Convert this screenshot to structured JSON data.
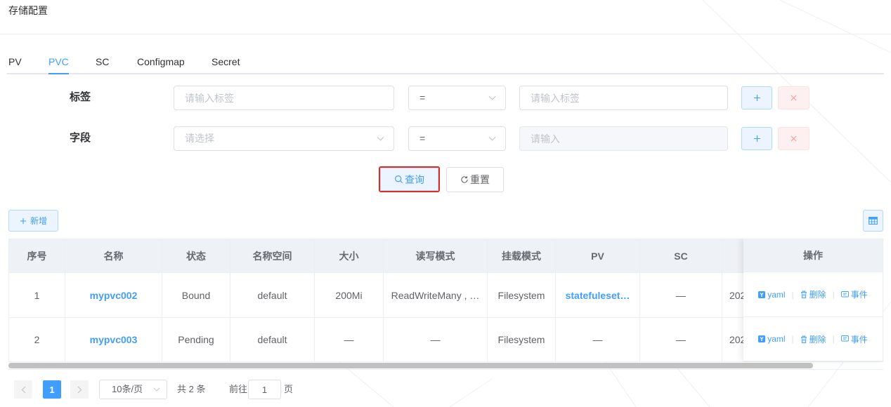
{
  "page": {
    "title": "存储配置"
  },
  "tabs": [
    {
      "label": "PV",
      "active": false
    },
    {
      "label": "PVC",
      "active": true
    },
    {
      "label": "SC",
      "active": false
    },
    {
      "label": "Configmap",
      "active": false
    },
    {
      "label": "Secret",
      "active": false
    }
  ],
  "filters": {
    "label_row": {
      "label": "标签",
      "key_placeholder": "请输入标签",
      "operator": "=",
      "value_placeholder": "请输入标签"
    },
    "field_row": {
      "label": "字段",
      "key_placeholder": "请选择",
      "operator": "=",
      "value_placeholder": "请输入",
      "value_disabled": true
    }
  },
  "actions": {
    "query_label": "查询",
    "reset_label": "重置",
    "add_label": "新增"
  },
  "table": {
    "columns": {
      "index": "序号",
      "name": "名称",
      "status": "状态",
      "namespace": "名称空间",
      "size": "大小",
      "access_mode": "读写模式",
      "volume_mode": "挂载模式",
      "pv": "PV",
      "sc": "SC",
      "actions": "操作"
    },
    "rows": [
      {
        "index": "1",
        "name": "mypvc002",
        "status": "Bound",
        "namespace": "default",
        "size": "200Mi",
        "access_mode": "ReadWriteMany , …",
        "volume_mode": "Filesystem",
        "pv": "statefuleset…",
        "sc": "—",
        "created": "202"
      },
      {
        "index": "2",
        "name": "mypvc003",
        "status": "Pending",
        "namespace": "default",
        "size": "—",
        "access_mode": "—",
        "volume_mode": "Filesystem",
        "pv": "—",
        "sc": "—",
        "created": "202"
      }
    ],
    "row_actions": {
      "yaml": "yaml",
      "delete": "删除",
      "events": "事件"
    }
  },
  "pagination": {
    "current_page": "1",
    "page_size": "10条/页",
    "total": "共 2 条",
    "goto_prefix": "前往",
    "goto_value": "1",
    "goto_suffix": "页"
  },
  "icons": {
    "query": "search-icon",
    "reset": "refresh-icon",
    "add": "plus-icon",
    "remove": "close-icon",
    "columns": "table-columns-icon",
    "select": "chevron-down-icon",
    "yaml": "yaml-icon",
    "delete": "trash-icon",
    "events": "message-icon",
    "prev": "chevron-left-icon",
    "next": "chevron-right-icon"
  },
  "colors": {
    "primary": "#409eff",
    "danger": "#f56c6c",
    "highlight": "#e02b20",
    "text": "#606266",
    "border": "#dcdfe6",
    "header_bg": "#eef1f6"
  }
}
